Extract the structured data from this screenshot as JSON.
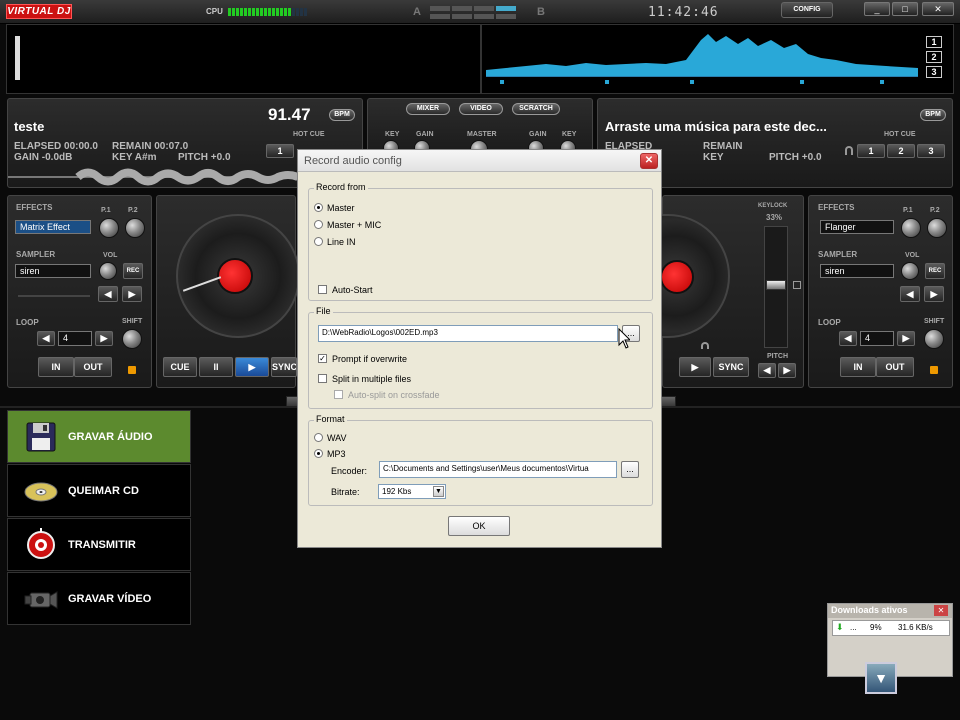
{
  "topbar": {
    "logo": "VIRTUAL DJ",
    "cpu_label": "CPU",
    "crossfader_a": "A",
    "crossfader_b": "B",
    "clock": "11:42:46",
    "config_label": "CONFIG",
    "window_buttons": [
      "_",
      "□",
      "✕"
    ]
  },
  "waveform": {
    "zoom_levels": [
      "1",
      "2",
      "3"
    ]
  },
  "deck_left": {
    "title": "teste",
    "bpm": "91.47",
    "bpm_label": "BPM",
    "elapsed": "ELAPSED 00:00.0",
    "remain": "REMAIN 00:07.0",
    "gain": "GAIN -0.0dB",
    "key": "KEY A#m",
    "pitch": "PITCH +0.0",
    "hot_cue_label": "HOT CUE",
    "hot_cues": [
      "1"
    ],
    "effects_label": "EFFECTS",
    "effect_value": "Matrix Effect",
    "p1": "P.1",
    "p2": "P.2",
    "sampler_label": "SAMPLER",
    "sampler_value": "siren",
    "vol_label": "VOL",
    "rec_label": "REC",
    "loop_label": "LOOP",
    "loop_value": "4",
    "shift_label": "SHIFT",
    "in_label": "IN",
    "out_label": "OUT",
    "transport": [
      "CUE",
      "II",
      "▶",
      "SYNC"
    ],
    "platter_label": "VIRTUAL DJ"
  },
  "deck_right": {
    "title": "Arraste uma música para este dec...",
    "bpm_label": "BPM",
    "elapsed": "ELAPSED",
    "remain": "REMAIN",
    "key": "KEY",
    "pitch": "PITCH +0.0",
    "hot_cue_label": "HOT CUE",
    "hot_cues": [
      "1",
      "2",
      "3"
    ],
    "keylock_label": "KEYLOCK",
    "keylock_value": "33%",
    "pitch_label": "PITCH",
    "effects_label": "EFFECTS",
    "effect_value": "Flanger",
    "p1": "P.1",
    "p2": "P.2",
    "sampler_label": "SAMPLER",
    "sampler_value": "siren",
    "vol_label": "VOL",
    "rec_label": "REC",
    "loop_label": "LOOP",
    "loop_value": "4",
    "shift_label": "SHIFT",
    "in_label": "IN",
    "out_label": "OUT",
    "transport": [
      "▶",
      "SYNC"
    ],
    "platter_label": "VIRTUAL DJ"
  },
  "mixer": {
    "tabs": [
      "MIXER",
      "VIDEO",
      "SCRATCH"
    ],
    "knob_labels": [
      "KEY",
      "GAIN",
      "MASTER",
      "GAIN",
      "KEY"
    ]
  },
  "left_menu": [
    {
      "label": "GRAVAR ÁUDIO",
      "icon": "floppy-disk-icon"
    },
    {
      "label": "QUEIMAR CD",
      "icon": "cd-icon"
    },
    {
      "label": "TRANSMITIR",
      "icon": "broadcast-icon"
    },
    {
      "label": "GRAVAR VÍDEO",
      "icon": "video-camera-icon"
    }
  ],
  "dialog": {
    "title": "Record audio config",
    "record_from_label": "Record from",
    "record_options": [
      "Master",
      "Master + MIC",
      "Line IN"
    ],
    "record_selected": "Master",
    "auto_start_label": "Auto-Start",
    "file_label": "File",
    "file_path": "D:\\WebRadio\\Logos\\002ED.mp3",
    "browse_label": "...",
    "prompt_overwrite_label": "Prompt if overwrite",
    "split_label": "Split in multiple files",
    "auto_split_label": "Auto-split on crossfade",
    "format_label": "Format",
    "format_options": [
      "WAV",
      "MP3"
    ],
    "format_selected": "MP3",
    "encoder_label": "Encoder:",
    "encoder_path": "C:\\Documents and Settings\\user\\Meus documentos\\Virtua",
    "bitrate_label": "Bitrate:",
    "bitrate_value": "192 Kbs",
    "ok_label": "OK"
  },
  "downloads": {
    "title": "Downloads ativos",
    "dots": "...",
    "percent": "9%",
    "speed": "31.6 KB/s"
  }
}
